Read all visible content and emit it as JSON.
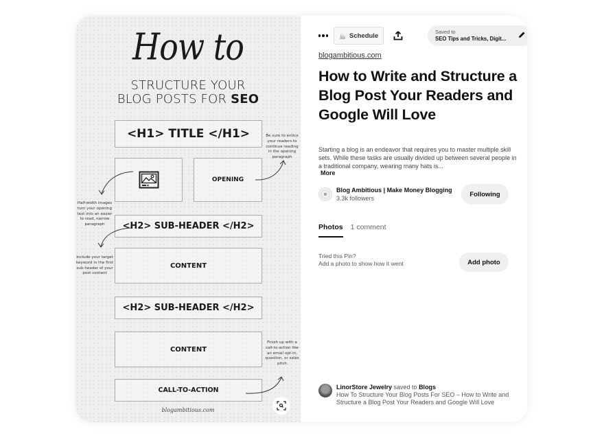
{
  "pin_image": {
    "script_title": "How to",
    "headline_line1": "STRUCTURE YOUR",
    "headline_line2_prefix": "BLOG POSTS FOR ",
    "headline_line2_emphasis": "SEO",
    "boxes": {
      "h1": "<H1> TITLE </H1>",
      "opening": "OPENING",
      "h2a": "<H2> SUB-HEADER </H2>",
      "content1": "CONTENT",
      "h2b": "<H2> SUB-HEADER </H2>",
      "content2": "CONTENT",
      "cta": "CALL-TO-ACTION"
    },
    "notes": {
      "opening_tip": "Be sure to entice your readers to continue reading in the opening paragraph",
      "image_tip": "Half-width images turn your opening text into an easier to read, narrow paragraph",
      "keyword_tip": "Include your target keyword in the first sub-header of your post content",
      "cta_tip": "Finish up with a call-to-action like an email opt-in, question, or sales pitch"
    },
    "signature": "blogambitious.com",
    "visual_search_icon": "visual-search-icon"
  },
  "toolbar": {
    "more_icon": "ellipsis-icon",
    "schedule_label": "Schedule",
    "share_icon": "share-upload-icon",
    "saved_to_label": "Saved to",
    "saved_to_board": "SEO Tips and Tricks, Digit...",
    "edit_icon": "pencil-icon"
  },
  "pin": {
    "source": "blogambitious.com",
    "title": "How to Write and Structure a Blog Post Your Readers and Google Will Love",
    "description": "Starting a blog is an endeavor that requires you to master multiple skill sets. While these tasks are usually divided up between several people in a traditional company, wearing many hats is...",
    "more_label": "More"
  },
  "creator": {
    "name": "Blog Ambitious | Make Money Blogging",
    "followers": "3.3k followers",
    "follow_button": "Following"
  },
  "tabs": [
    {
      "label": "Photos",
      "active": true
    },
    {
      "label": "1 comment",
      "active": false
    }
  ],
  "tried": {
    "line1": "Tried this Pin?",
    "line2": "Add a photo to show how it went",
    "button": "Add photo"
  },
  "activity": {
    "user": "LinorStore Jewelry",
    "action": " saved to ",
    "board": "Blogs",
    "text": "How To Structure Your Blog Posts For SEO – How to Write and Structure a Blog Post Your Readers and Google Will Love"
  }
}
